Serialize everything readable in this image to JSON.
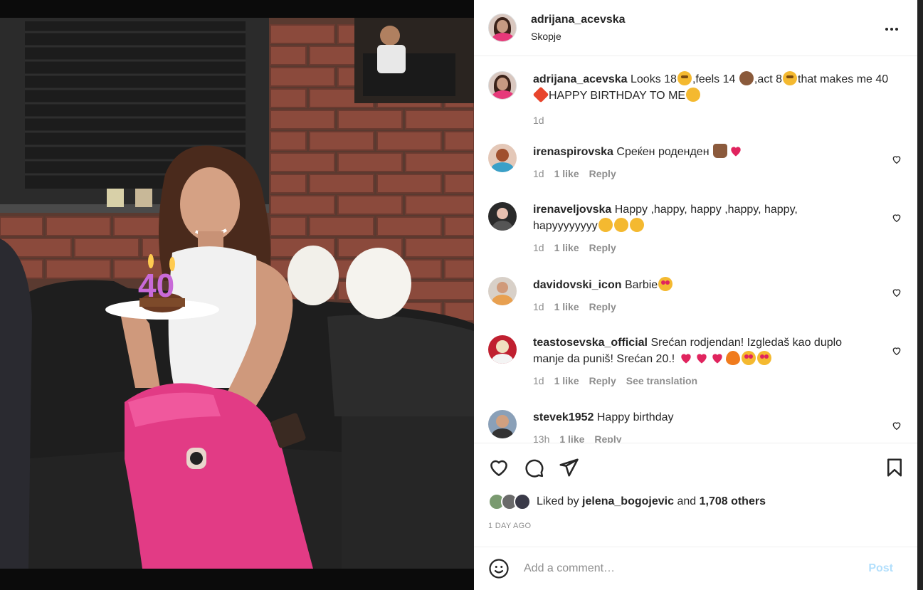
{
  "post": {
    "username": "adrijana_acevska",
    "location": "Skopje",
    "caption_user": "adrijana_acevska",
    "caption_parts": [
      "Looks 18",
      ",feels 14",
      ",act 8",
      "that makes me",
      "40",
      "HAPPY BIRTHDAY TO ME"
    ],
    "caption_age": "1d"
  },
  "photo": {
    "candle_text": "40"
  },
  "comments": [
    {
      "user": "irenaspirovska",
      "text": "Среќен роденден",
      "age": "1d",
      "likes": "1 like",
      "reply": "Reply"
    },
    {
      "user": "irenaveljovska",
      "text": "Happy ,happy, happy ,happy, happy,",
      "text2": "hapyyyyyyyy",
      "age": "1d",
      "likes": "1 like",
      "reply": "Reply"
    },
    {
      "user": "davidovski_icon",
      "text": "Barbie",
      "age": "1d",
      "likes": "1 like",
      "reply": "Reply"
    },
    {
      "user": "teastosevska_official",
      "text": "Srećan rodjendan! Izgledaš kao duplo",
      "text2": "manje da puniš! Srećan 20.!",
      "age": "1d",
      "likes": "1 like",
      "reply": "Reply",
      "translate": "See translation"
    },
    {
      "user": "stevek1952",
      "text": "Happy birthday",
      "age": "13h",
      "likes": "1 like",
      "reply": "Reply"
    }
  ],
  "likes": {
    "prefix": "Liked by",
    "user": "jelena_bogojevic",
    "and": "and",
    "count": "1,708 others"
  },
  "time_ago": "1 DAY AGO",
  "comment_box": {
    "placeholder": "Add a comment…",
    "post_label": "Post"
  },
  "icons": {
    "more": "more-options-icon",
    "like": "heart-icon",
    "comment": "comment-bubble-icon",
    "share": "paper-plane-icon",
    "save": "bookmark-icon",
    "emoji": "emoji-smile-icon"
  },
  "colors": {
    "text": "#262626",
    "muted": "#8e8e8e",
    "post_button": "#b2dffc",
    "divider": "#efefef",
    "heart_red": "#e0245e"
  }
}
